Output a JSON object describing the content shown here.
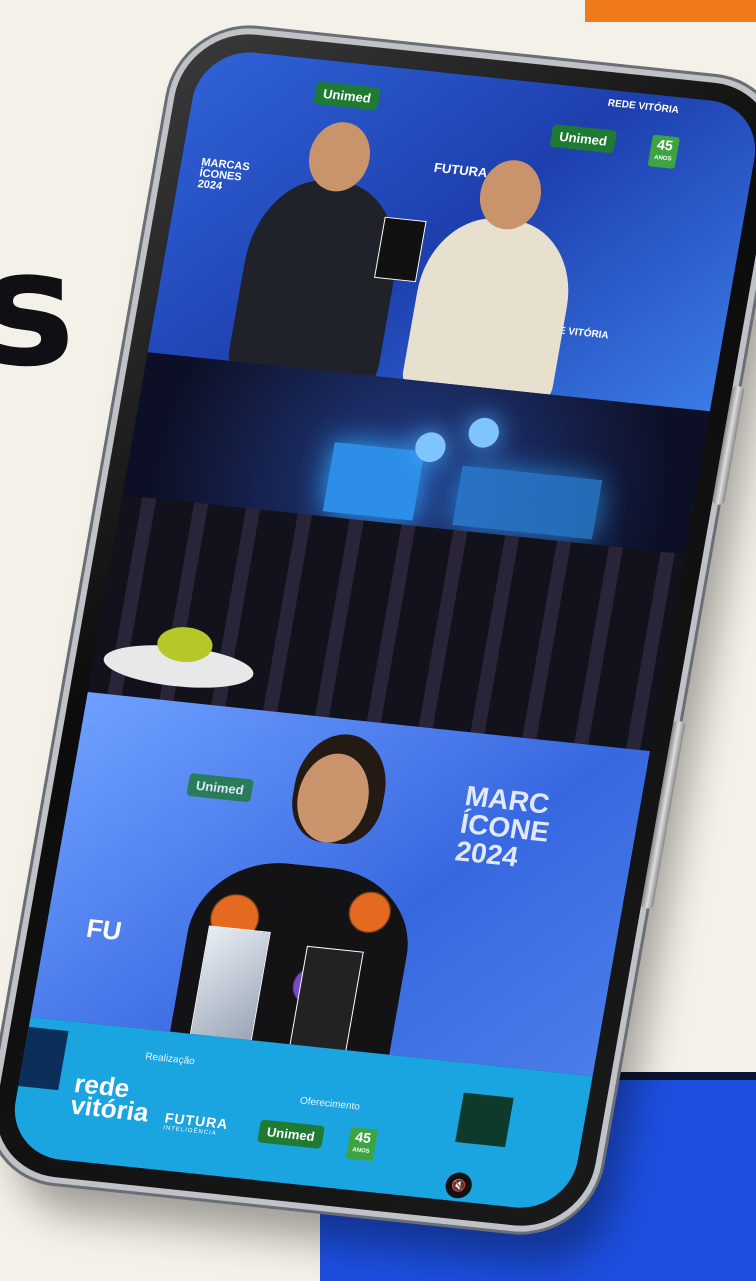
{
  "background": {
    "accent_orange": "#f07a1a",
    "accent_blue": "#1d4fe0",
    "cream": "#f4f1e8",
    "glyph": "s"
  },
  "panel1": {
    "unimed": "Unimed",
    "anos_num": "45",
    "anos_label": "ANOS",
    "event_lines": [
      "MARCAS",
      "ÍCONES",
      "2024"
    ],
    "futura": "FUTURA",
    "rede": "REDE VITÓRIA"
  },
  "panel3": {
    "unimed": "Unimed",
    "event_lines": [
      "MARC",
      "ÍCONE",
      "2024"
    ],
    "futura": "FU"
  },
  "footer": {
    "realizacao": "Realização",
    "oferecimento": "Oferecimento",
    "rede_line1": "rede",
    "rede_line2": "vitória",
    "futura": "FUTURA",
    "futura_sub": "INTELIGÊNCIA",
    "unimed": "Unimed",
    "anos_num": "45",
    "anos_label": "ANOS"
  },
  "icons": {
    "mute": "muted-speaker-icon"
  }
}
